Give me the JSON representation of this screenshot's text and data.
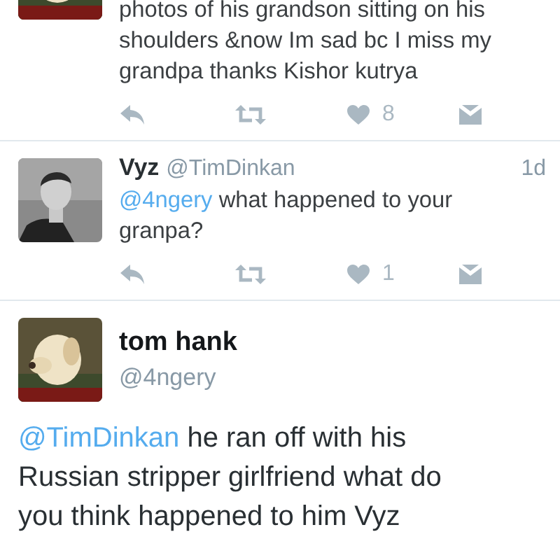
{
  "tweets": [
    {
      "kind": "cut",
      "body": {
        "text": "photos of his grandson sitting on his shoulders &now Im sad bc I miss my grandpa thanks Kishor kutrya"
      },
      "likes": "8"
    },
    {
      "kind": "reply",
      "name": "Vyz",
      "handle": "@TimDinkan",
      "time": "1d",
      "body": {
        "mention": "@4ngery",
        "text": " what happened to your granpa?"
      },
      "likes": "1"
    },
    {
      "kind": "detail",
      "name": "tom hank",
      "handle": "@4ngery",
      "body": {
        "mention": "@TimDinkan",
        "text": " he ran off with his Russian stripper girlfriend what do you think happened to him Vyz"
      }
    }
  ]
}
